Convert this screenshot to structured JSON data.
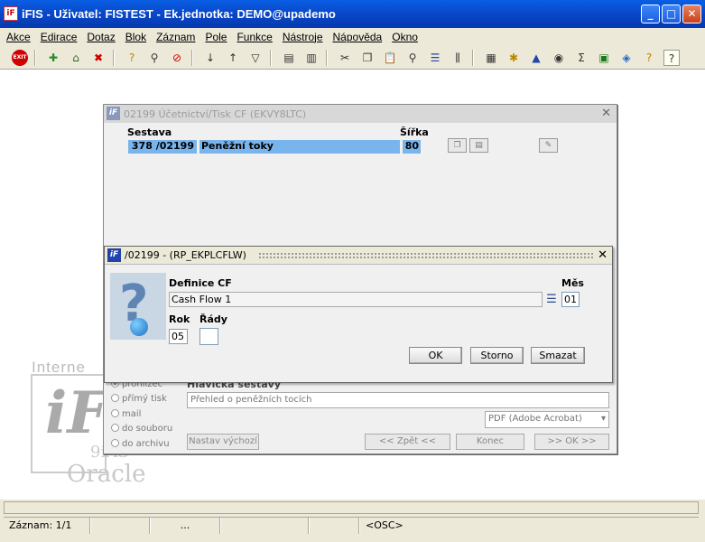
{
  "window": {
    "title": "iFIS - Uživatel: FISTEST - Ek.jednotka: DEMO@upademo"
  },
  "menu": [
    "Akce",
    "Edirace",
    "Dotaz",
    "Blok",
    "Záznam",
    "Pole",
    "Funkce",
    "Nástroje",
    "Nápověda",
    "Okno"
  ],
  "toolbar": {
    "exit_label": "EXIT",
    "icons": [
      "exit-icon",
      "insert-record-icon",
      "save-icon",
      "delete-record-icon",
      "query-icon",
      "execute-query-icon",
      "cancel-query-icon",
      "sort-asc-icon",
      "sort-desc-icon",
      "filter-icon",
      "print-icon",
      "print-preview-icon",
      "cut-icon",
      "copy-icon",
      "paste-icon",
      "search-icon",
      "list-icon",
      "columns-icon",
      "calculator-icon",
      "tools-icon",
      "chart-icon",
      "settings-icon",
      "sum-icon",
      "excel-icon",
      "export-icon",
      "help-context-icon",
      "help-icon"
    ]
  },
  "background_logo": {
    "internet": "Interne",
    "product": "9iAS",
    "vendor": "Oracle"
  },
  "back_window": {
    "title": "02199  Účetnictví/Tisk CF (EKVY8LTC)",
    "col_sestava": "Sestava",
    "col_sirka": "Šířka",
    "row": {
      "num": "378",
      "code": "/02199",
      "name": "Peněžní toky",
      "width": "80"
    },
    "output_header": "Hlavička sestavy",
    "radios": [
      "prohlížeč",
      "přímý tisk",
      "mail",
      "do souboru",
      "do archivu"
    ],
    "header_value": "Přehled o peněžních tocích",
    "format_value": "PDF (Adobe Acrobat)",
    "default_button": "Nastav výchozí",
    "back_button": "<< Zpět <<",
    "end_button": "Konec",
    "ok_button": ">> OK >>"
  },
  "dialog": {
    "title": "/02199 - (RP_EKPLCFLW)",
    "label_definice": "Definice CF",
    "definice_value": "Cash Flow 1",
    "label_mes": "Měs",
    "mes_value": "01",
    "label_rok": "Rok",
    "rok_value": "05",
    "label_rady": "Řády",
    "rady_value": "",
    "ok_button": "OK",
    "storno_button": "Storno",
    "smazat_button": "Smazat"
  },
  "statusbar": {
    "record": "Záznam: 1/1",
    "ellipsis": "...",
    "mode": "<OSC>"
  },
  "colors": {
    "titlebar": "#0846c8",
    "selection": "#7ab4ec",
    "chrome": "#ece9d8"
  }
}
